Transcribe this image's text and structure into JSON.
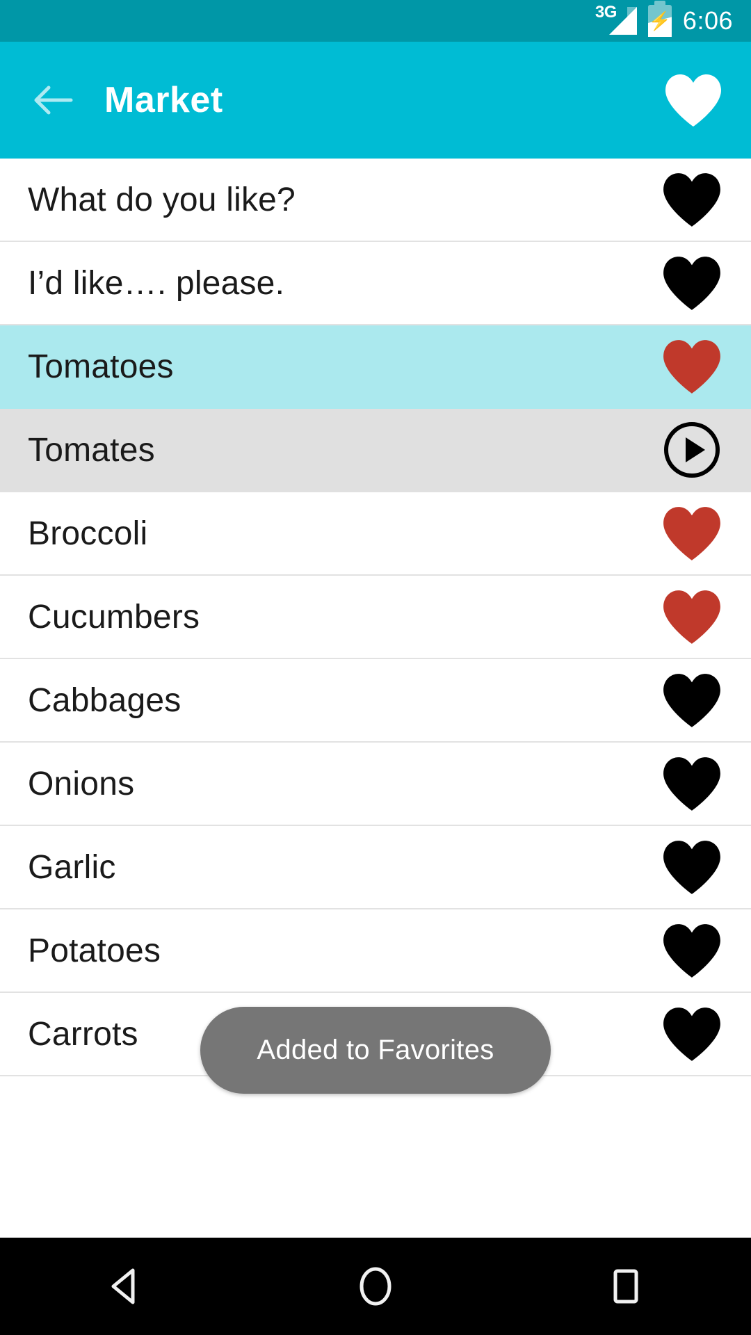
{
  "status_bar": {
    "network": "3G",
    "battery_icon": "battery-charging-icon",
    "signal_icon": "signal-bars-icon",
    "time": "6:06"
  },
  "app_bar": {
    "back_icon": "back-arrow-icon",
    "title": "Market",
    "favorite_icon": "heart-filled-icon",
    "background_color": "#00BCD4"
  },
  "list": {
    "rows": [
      {
        "label": "What do you like?",
        "icon": "heart-filled-icon",
        "icon_color": "#000000",
        "state": "default"
      },
      {
        "label": "I’d like…. please.",
        "icon": "heart-filled-icon",
        "icon_color": "#000000",
        "state": "default"
      },
      {
        "label": "Tomatoes",
        "icon": "heart-filled-icon",
        "icon_color": "#C0392B",
        "state": "highlighted"
      },
      {
        "label": "Tomates",
        "icon": "play-circle-icon",
        "icon_color": "#000000",
        "state": "playing"
      },
      {
        "label": "Broccoli",
        "icon": "heart-filled-icon",
        "icon_color": "#C0392B",
        "state": "default"
      },
      {
        "label": "Cucumbers",
        "icon": "heart-filled-icon",
        "icon_color": "#C0392B",
        "state": "default"
      },
      {
        "label": "Cabbages",
        "icon": "heart-filled-icon",
        "icon_color": "#000000",
        "state": "default"
      },
      {
        "label": "Onions",
        "icon": "heart-filled-icon",
        "icon_color": "#000000",
        "state": "default"
      },
      {
        "label": "Garlic",
        "icon": "heart-filled-icon",
        "icon_color": "#000000",
        "state": "default"
      },
      {
        "label": "Potatoes",
        "icon": "heart-filled-icon",
        "icon_color": "#000000",
        "state": "default"
      },
      {
        "label": "Carrots",
        "icon": "heart-filled-icon",
        "icon_color": "#000000",
        "state": "default"
      }
    ],
    "highlight_color": "#ABE9EE",
    "playing_color": "#E0E0E0"
  },
  "toast": {
    "message": "Added to Favorites",
    "background_color": "#767676"
  },
  "nav_bar": {
    "back": "nav-back-icon",
    "home": "nav-home-icon",
    "recents": "nav-recents-icon"
  }
}
